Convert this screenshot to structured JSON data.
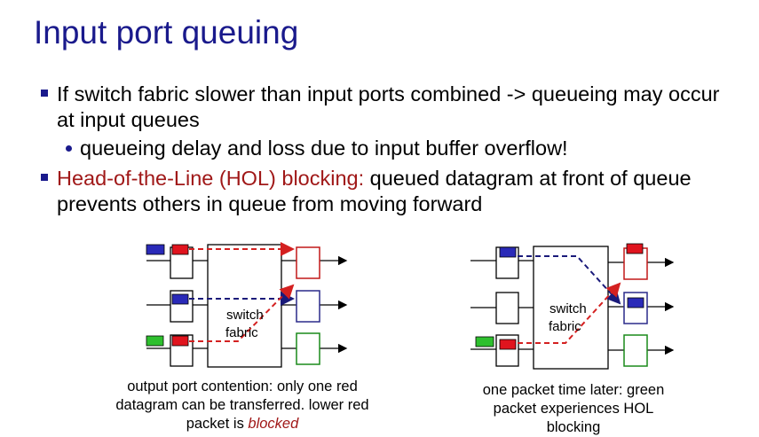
{
  "slide": {
    "title": "Input port queuing",
    "bullet1": "If switch fabric slower than input ports combined -> queueing may occur at input queues",
    "sub_bullet": "queueing delay and loss due to input buffer overflow!",
    "bullet2_highlight": "Head-of-the-Line (HOL) blocking:",
    "bullet2_rest": " queued datagram at front of queue prevents others in queue from moving forward"
  },
  "left_diagram": {
    "fabric_line1": "switch",
    "fabric_line2": "fabric",
    "caption_part1": "output port contention: only one red datagram can be transferred. lower red packet is ",
    "caption_blocked": "blocked"
  },
  "right_diagram": {
    "fabric_line1": "switch",
    "fabric_line2": "fabric",
    "caption": "one packet time later: green packet experiences HOL blocking"
  },
  "colors": {
    "title": "#1a1a8c",
    "highlight": "#a01818",
    "red_packet": "#e0141e",
    "blue_packet": "#2a2ab8",
    "green_packet": "#2ec02e",
    "red_path": "#d42020",
    "blue_path": "#1a1a7a"
  }
}
